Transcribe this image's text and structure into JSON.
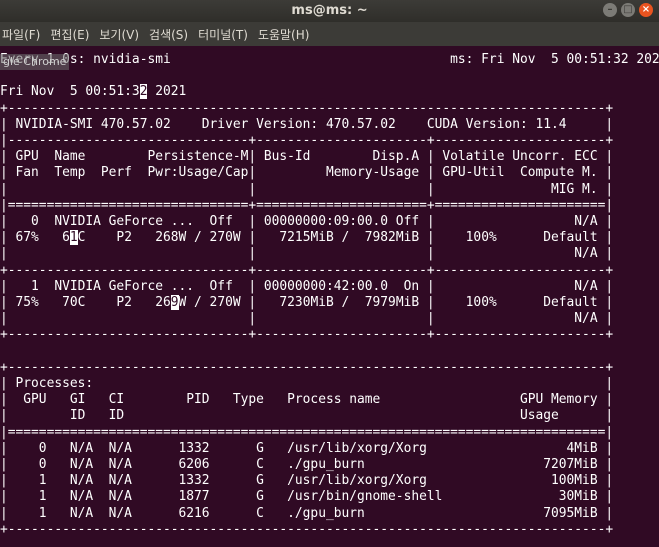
{
  "window": {
    "title": "ms@ms: ~",
    "controls": [
      "minimize-icon",
      "maximize-icon",
      "close-icon"
    ],
    "minimize_glyph": "–",
    "maximize_glyph": "□",
    "close_glyph": "×"
  },
  "menubar": {
    "items": [
      {
        "label": "파일(F)"
      },
      {
        "label": "편집(E)"
      },
      {
        "label": "보기(V)"
      },
      {
        "label": "검색(S)"
      },
      {
        "label": "터미널(T)"
      },
      {
        "label": "도움말(H)"
      }
    ]
  },
  "tooltip": {
    "text": "gle Chrome"
  },
  "terminal": {
    "lines": [
      {
        "text": "Every 1.0s: nvidia-smi                                    ms: Fri Nov  5 00:51:32 2021"
      },
      {
        "text": ""
      },
      {
        "text": "Fri Nov  5 00:51:3",
        "cursor": "2",
        "rest": " 2021"
      },
      {
        "text": "+-----------------------------------------------------------------------------+"
      },
      {
        "text": "| NVIDIA-SMI 470.57.02    Driver Version: 470.57.02    CUDA Version: 11.4     |"
      },
      {
        "text": "|-------------------------------+----------------------+----------------------+"
      },
      {
        "text": "| GPU  Name        Persistence-M| Bus-Id        Disp.A | Volatile Uncorr. ECC |"
      },
      {
        "text": "| Fan  Temp  Perf  Pwr:Usage/Cap|         Memory-Usage | GPU-Util  Compute M. |"
      },
      {
        "text": "|                               |                      |               MIG M. |"
      },
      {
        "text": "|===============================+======================+======================|"
      },
      {
        "text": "|   0  NVIDIA GeForce ...  Off  | 00000000:09:00.0 Off |                  N/A |"
      },
      {
        "text": "| 67%   6",
        "cursor": "1",
        "rest": "C    P2   268W / 270W |   7215MiB /  7982MiB |    100%      Default |"
      },
      {
        "text": "|                               |                      |                  N/A |"
      },
      {
        "text": "+-------------------------------+----------------------+----------------------+"
      },
      {
        "text": "|   1  NVIDIA GeForce ...  Off  | 00000000:42:00.0  On |                  N/A |"
      },
      {
        "text": "| 75%   70C    P2   26",
        "cursor": "9",
        "rest": "W / 270W |   7230MiB /  7979MiB |    100%      Default |"
      },
      {
        "text": "|                               |                      |                  N/A |"
      },
      {
        "text": "+-------------------------------+----------------------+----------------------+"
      },
      {
        "text": ""
      },
      {
        "text": "+-----------------------------------------------------------------------------+"
      },
      {
        "text": "| Processes:                                                                  |"
      },
      {
        "text": "|  GPU   GI   CI        PID   Type   Process name                  GPU Memory |"
      },
      {
        "text": "|        ID   ID                                                   Usage      |"
      },
      {
        "text": "|=============================================================================|"
      },
      {
        "text": "|    0   N/A  N/A      1332      G   /usr/lib/xorg/Xorg                  4MiB |"
      },
      {
        "text": "|    0   N/A  N/A      6206      C   ./gpu_burn                       7207MiB |"
      },
      {
        "text": "|    1   N/A  N/A      1332      G   /usr/lib/xorg/Xorg                100MiB |"
      },
      {
        "text": "|    1   N/A  N/A      1877      G   /usr/bin/gnome-shell               30MiB |"
      },
      {
        "text": "|    1   N/A  N/A      6216      C   ./gpu_burn                       7095MiB |"
      },
      {
        "text": "+-----------------------------------------------------------------------------+"
      }
    ]
  }
}
